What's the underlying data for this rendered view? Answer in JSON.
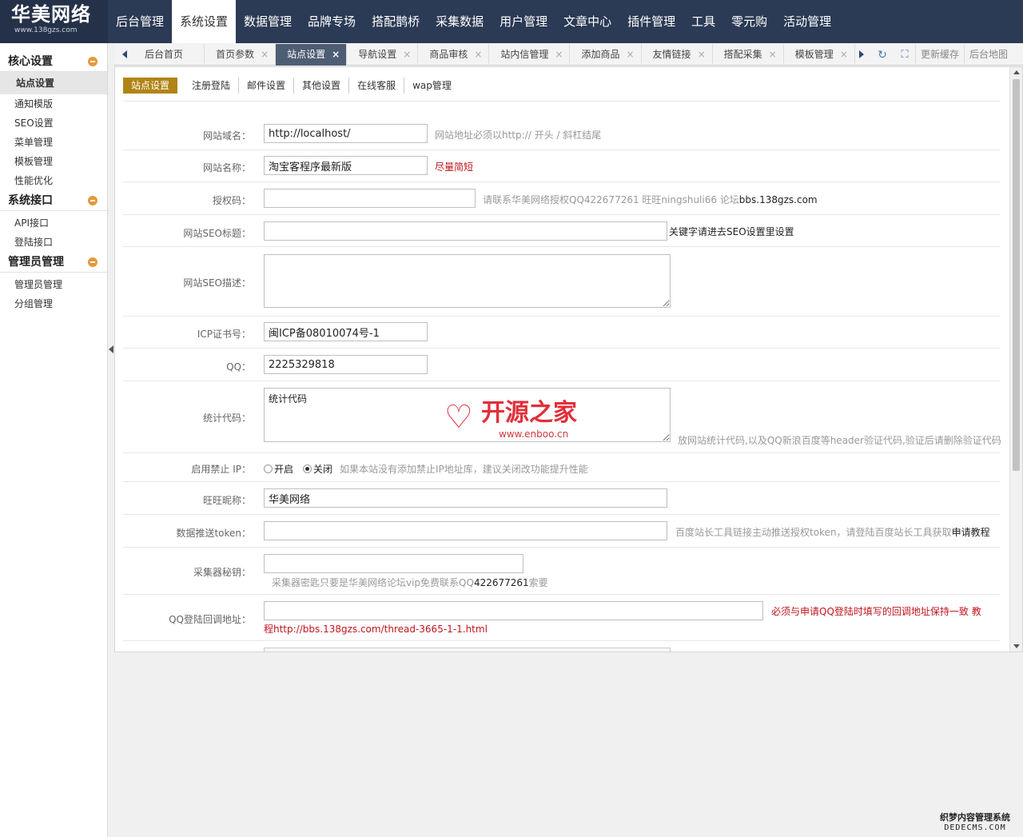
{
  "logo": {
    "main": "华美网络",
    "sub": "www.138gzs.com"
  },
  "topnav": [
    {
      "label": "后台管理"
    },
    {
      "label": "系统设置",
      "active": true
    },
    {
      "label": "数据管理"
    },
    {
      "label": "品牌专场"
    },
    {
      "label": "搭配鹊桥"
    },
    {
      "label": "采集数据"
    },
    {
      "label": "用户管理"
    },
    {
      "label": "文章中心"
    },
    {
      "label": "插件管理"
    },
    {
      "label": "工具"
    },
    {
      "label": "零元购"
    },
    {
      "label": "活动管理"
    }
  ],
  "sidebar": {
    "groups": [
      {
        "title": "核心设置",
        "items": [
          "站点设置",
          "通知模版",
          "SEO设置",
          "菜单管理",
          "模板管理",
          "性能优化"
        ]
      },
      {
        "title": "系统接口",
        "items": [
          "API接口",
          "登陆接口"
        ]
      },
      {
        "title": "管理员管理",
        "items": [
          "管理员管理",
          "分组管理"
        ]
      }
    ],
    "active_item": "站点设置"
  },
  "tabs": [
    {
      "label": "后台首页"
    },
    {
      "label": "首页参数"
    },
    {
      "label": "站点设置",
      "active": true
    },
    {
      "label": "导航设置"
    },
    {
      "label": "商品审核"
    },
    {
      "label": "站内信管理"
    },
    {
      "label": "添加商品"
    },
    {
      "label": "友情链接"
    },
    {
      "label": "搭配采集"
    },
    {
      "label": "模板管理"
    }
  ],
  "tab_tools": {
    "clear_cache": "更新缓存",
    "sitemap": "后台地图"
  },
  "subtabs": [
    "站点设置",
    "注册登陆",
    "邮件设置",
    "其他设置",
    "在线客服",
    "wap管理"
  ],
  "form": {
    "domain": {
      "label": "网站域名：",
      "value": "http://localhost/",
      "hint": "网站地址必须以http:// 开头 / 斜杠结尾"
    },
    "site_name": {
      "label": "网站名称：",
      "value": "淘宝客程序最新版",
      "hint": "尽量简短"
    },
    "auth_code": {
      "label": "授权码：",
      "value": "",
      "hint": "请联系华美网络授权QQ422677261 旺旺ningshuli66 论坛",
      "hint_strong": "bbs.138gzs.com"
    },
    "seo_title": {
      "label": "网站SEO标题：",
      "value": "",
      "hint": "关键字请进去SEO设置里设置"
    },
    "seo_desc": {
      "label": "网站SEO描述：",
      "value": ""
    },
    "icp": {
      "label": "ICP证书号：",
      "value": "闽ICP备08010074号-1"
    },
    "qq": {
      "label": "QQ：",
      "value": "2225329818"
    },
    "stats": {
      "label": "统计代码：",
      "value": "统计代码",
      "hint": "放网站统计代码,以及QQ新浪百度等header验证代码,验证后请删除验证代码"
    },
    "ip_ban": {
      "label": "启用禁止 IP：",
      "on": "开启",
      "off": "关闭",
      "hint": "如果本站没有添加禁止IP地址库，建议关闭改功能提升性能"
    },
    "wangwang": {
      "label": "旺旺昵称：",
      "value": "华美网络"
    },
    "token": {
      "label": "数据推送token：",
      "value": "",
      "hint": "百度站长工具链接主动推送授权token，请登陆百度站长工具获取",
      "hint_strong": "申请教程"
    },
    "collector_key": {
      "label": "采集器秘钥：",
      "value": "",
      "hint": "采集器密匙只要是华美网络论坛vip免费联系QQ",
      "hint_strong": "422677261",
      "hint_tail": "索要"
    },
    "qq_callback": {
      "label": "QQ登陆回调地址：",
      "value": "",
      "hint": "必须与申请QQ登陆时填写的回调地址保持一致 教",
      "hint2": "程http://bbs.138gzs.com/thread-3665-1-1.html"
    }
  },
  "watermark": {
    "text": "开源之家",
    "url": "www.enboo.cn"
  },
  "corner": {
    "line1": "织梦内容管理系统",
    "line2": "DEDECMS.COM"
  },
  "colors": {
    "header_bg": "#2b3a55",
    "active_subtab": "#b08414",
    "active_tab": "#4d5d73",
    "red_hint": "#c0141c"
  }
}
